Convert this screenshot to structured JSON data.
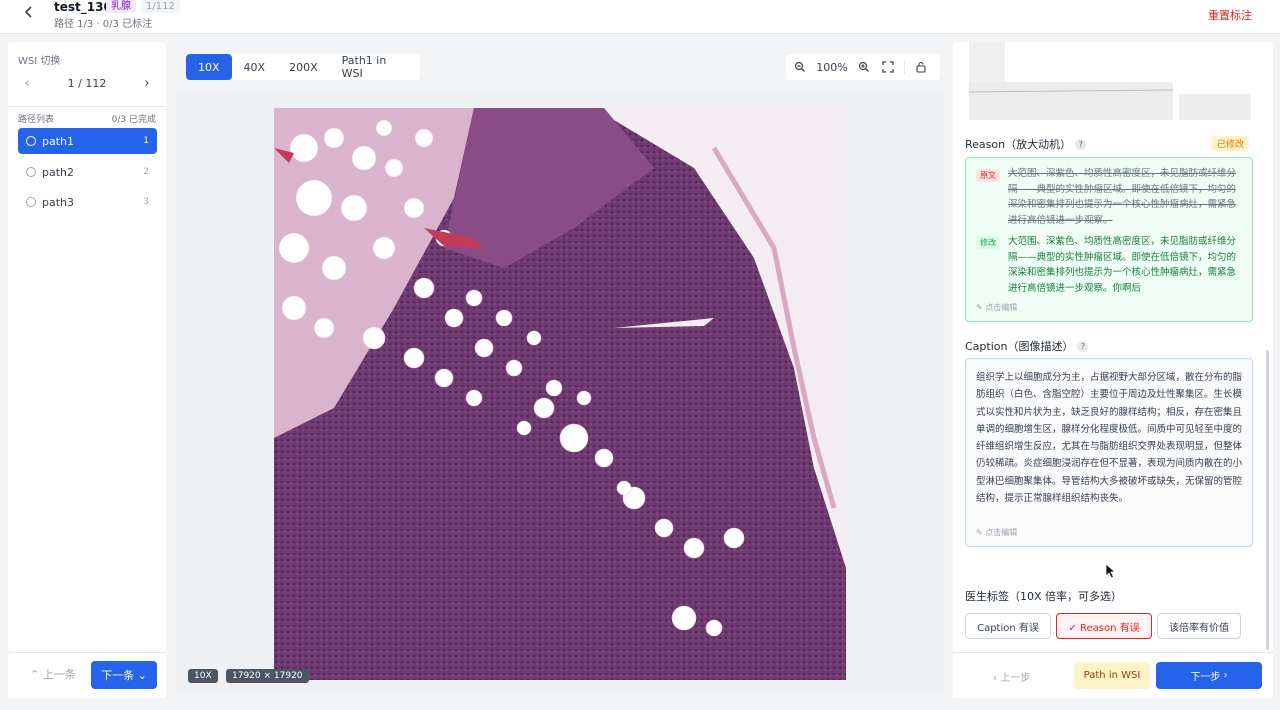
{
  "header": {
    "title": "test_130",
    "organ_tag": "乳腺",
    "count_tag": "1/112",
    "path_info": "路径 1/3 · 0/3 已标注",
    "reset_label": "重置标注"
  },
  "left": {
    "wsi_label": "WSI 切换",
    "pager_text": "1 / 112",
    "list_title": "路径列表",
    "list_status": "0/3 已完成",
    "paths": [
      {
        "label": "path1",
        "num": "1"
      },
      {
        "label": "path2",
        "num": "2"
      },
      {
        "label": "path3",
        "num": "3"
      }
    ],
    "prev_label": "上一条",
    "next_label": "下一条"
  },
  "viewer": {
    "zoom_tabs": [
      "10X",
      "40X",
      "200X",
      "Path1 in WSI"
    ],
    "active_tab": "10X",
    "zoom_level": "100%",
    "mag_badge": "10X",
    "size_badge": "17920 × 17920"
  },
  "right": {
    "reason_title": "Reason（放大动机）",
    "modified_badge": "已修改",
    "orig_tag": "原文",
    "mod_tag": "修改",
    "reason_original": "大范围、深紫色、均质性高密度区，未见脂肪或纤维分隔——典型的实性肿瘤区域。即使在低倍镜下，均匀的深染和密集排列也提示为一个核心性肿瘤病灶，需紧急进行高倍镜进一步观察。",
    "reason_modified": "大范围、深紫色、均质性高密度区，未见脂肪或纤维分隔——典型的实性肿瘤区域。即使在低倍镜下，均匀的深染和密集排列也提示为一个核心性肿瘤病灶，需紧急进行高倍镜进一步观察。你啊后",
    "edit_hint": "点击编辑",
    "caption_title": "Caption（图像描述）",
    "caption_text": "组织学上以细胞成分为主，占据视野大部分区域，散在分布的脂肪组织（白色、含脂空腔）主要位于周边及灶性聚集区。生长模式以实性和片状为主，缺乏良好的腺样结构；相反，存在密集且单调的细胞增生区，腺样分化程度极低。间质中可见轻至中度的纤维组织增生反应，尤其在与脂肪组织交界处表现明显，但整体仍较稀疏。炎症细胞浸润存在但不显著，表现为间质内散在的小型淋巴细胞聚集体。导管结构大多被破坏或缺失，无保留的管腔结构，提示正常腺样组织结构丧失。",
    "doctor_title": "医生标签（10X 倍率，可多选）",
    "tags": [
      "Caption 有误",
      "✓ Reason 有误",
      "该倍率有价值"
    ],
    "prev_label": "上一步",
    "path_wsi_label": "Path in WSI",
    "next_label": "下一步"
  },
  "colors": {
    "accent": "#2563eb",
    "danger": "#dc2626",
    "success": "#16a34a",
    "tissue": "#7b3f78"
  }
}
